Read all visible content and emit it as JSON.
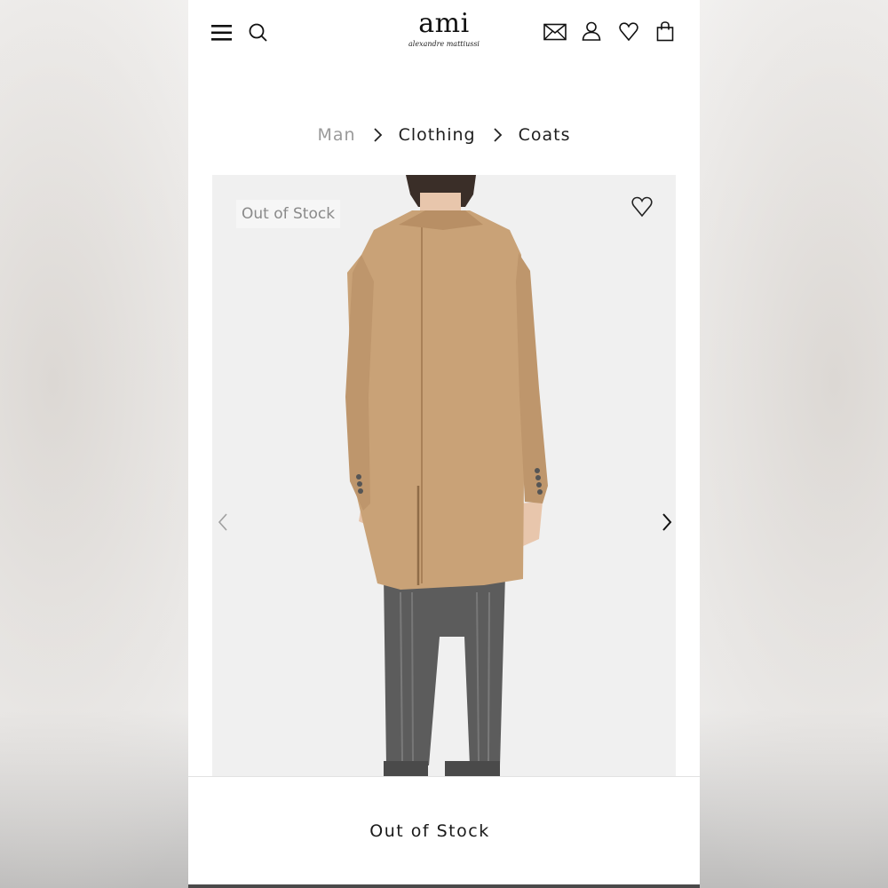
{
  "header": {
    "brand": "ami",
    "brand_sub": "alexandre mattiussi",
    "icons": [
      "menu-icon",
      "search-icon",
      "mail-icon",
      "account-icon",
      "wishlist-icon",
      "bag-icon"
    ]
  },
  "breadcrumb": {
    "items": [
      "Man",
      "Clothing",
      "Coats"
    ]
  },
  "product": {
    "badge": "Out of Stock",
    "image_desc": "camel coat back view",
    "colors": {
      "coat": "#c9a277",
      "trousers": "#5a5a5a",
      "background": "#f0f0f0"
    }
  },
  "footer": {
    "stock_label": "Out of Stock"
  }
}
